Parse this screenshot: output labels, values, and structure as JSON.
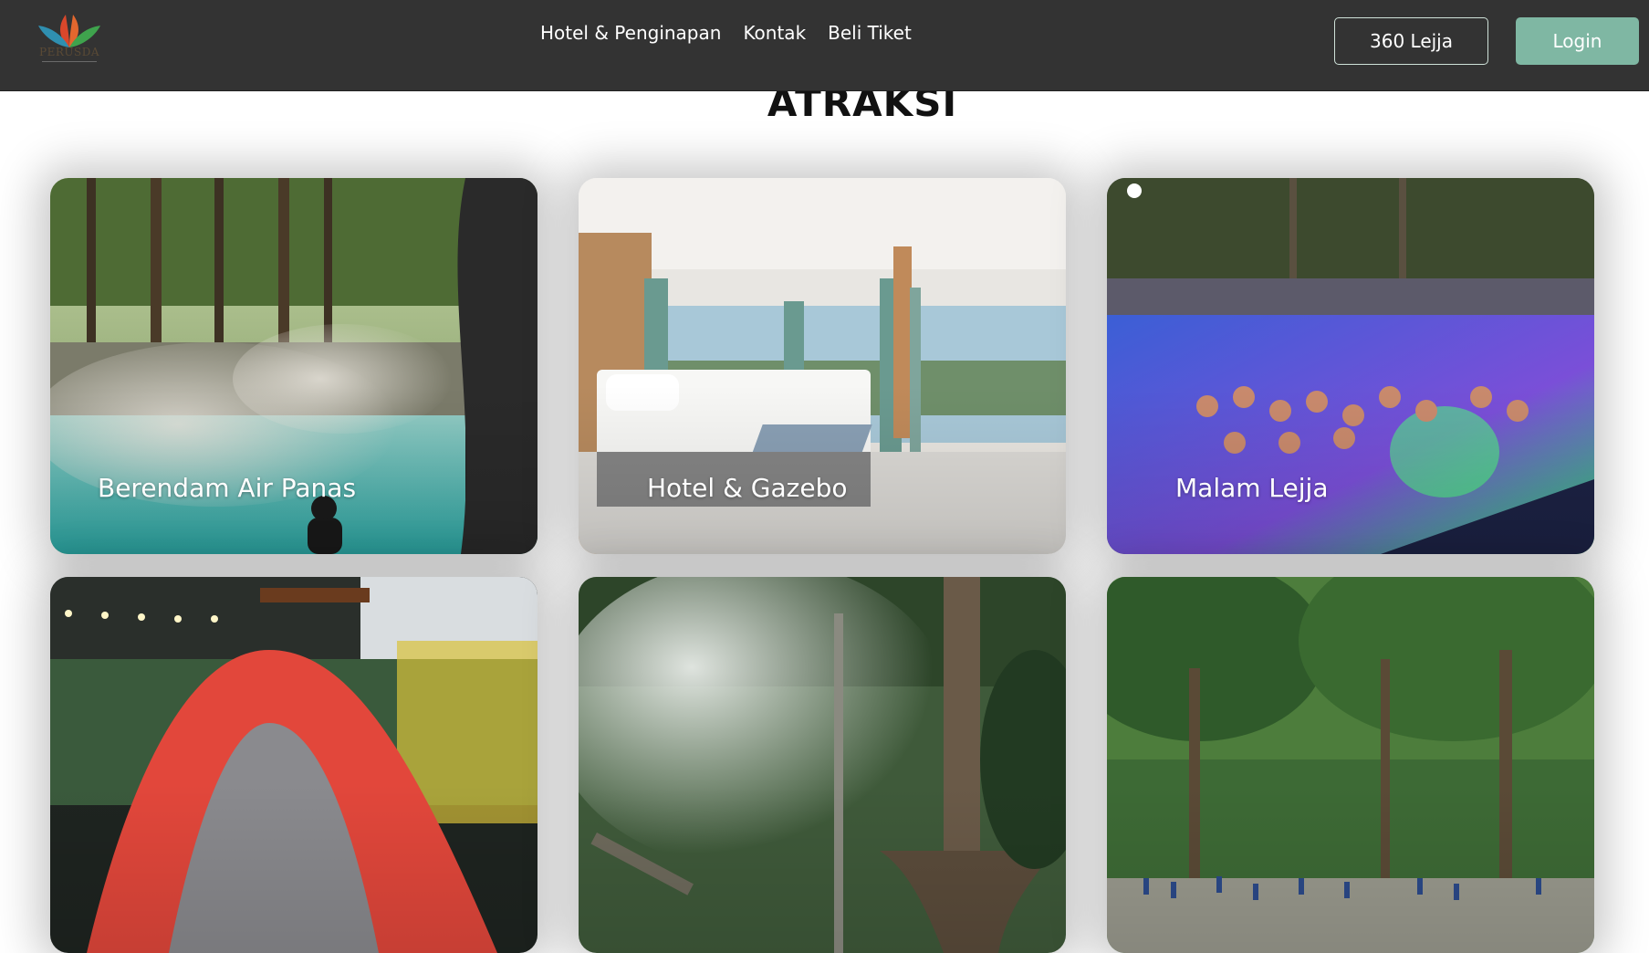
{
  "navbar": {
    "logo_text": "PERUSDA",
    "links": [
      "Hotel & Penginapan",
      "Kontak",
      "Beli Tiket"
    ],
    "btn_360": "360 Lejja",
    "btn_login": "Login"
  },
  "section": {
    "title": "ATRAKSI"
  },
  "cards": [
    {
      "label": "Berendam Air Panas"
    },
    {
      "label": "Hotel & Gazebo"
    },
    {
      "label": "Malam Lejja"
    },
    {
      "label": ""
    },
    {
      "label": ""
    },
    {
      "label": ""
    }
  ],
  "colors": {
    "navbar_bg": "#333333",
    "login_button": "#7fb7a3",
    "outline_button_border": "#cfe2d9",
    "title_text": "#111111"
  }
}
